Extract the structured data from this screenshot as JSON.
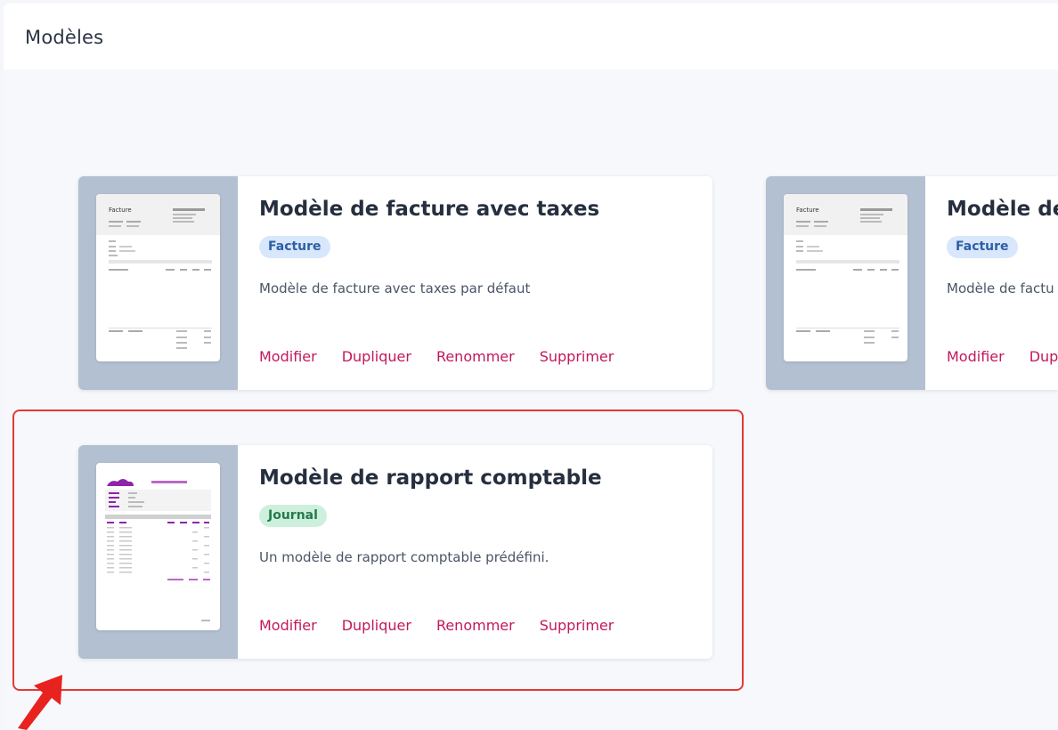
{
  "header": {
    "title": "Modèles"
  },
  "templates": [
    {
      "title": "Modèle de facture avec taxes",
      "badge": "Facture",
      "description": "Modèle de facture avec taxes par défaut",
      "actions": [
        "Modifier",
        "Dupliquer",
        "Renommer",
        "Supprimer"
      ],
      "preview_heading": "Facture"
    },
    {
      "title": "Modèle de",
      "badge": "Facture",
      "description": "Modèle de factu",
      "actions": [
        "Modifier",
        "Dup"
      ],
      "preview_heading": "Facture"
    },
    {
      "title": "Modèle de rapport comptable",
      "badge": "Journal",
      "description": "Un modèle de rapport comptable prédéfini.",
      "actions": [
        "Modifier",
        "Dupliquer",
        "Renommer",
        "Supprimer"
      ]
    }
  ],
  "colors": {
    "action": "#c2185b",
    "highlight": "#e53935",
    "thumb_panel": "#b3c0d1"
  }
}
